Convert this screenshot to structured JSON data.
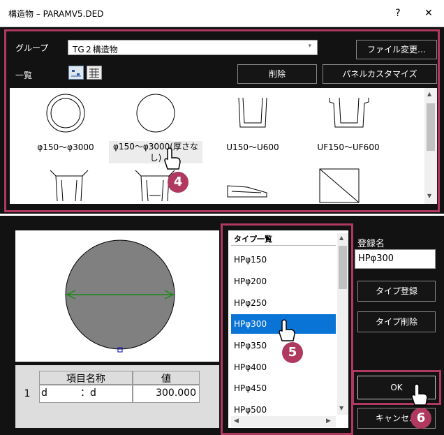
{
  "window": {
    "title": "構造物 – PARAMV5.DED",
    "help": "?",
    "close": "✕"
  },
  "top": {
    "group_label": "グループ",
    "group_value": "TG２構造物",
    "file_change": "ファイル変更…",
    "list_label": "一覧",
    "delete": "削除",
    "panel_custom": "パネルカスタマイズ"
  },
  "shapes": [
    {
      "label": "φ150～φ3000",
      "icon": "double-circle-icon"
    },
    {
      "label": "φ150～φ3000(厚さなし)",
      "icon": "circle-icon"
    },
    {
      "label": "U150～U600",
      "icon": "u-channel-icon"
    },
    {
      "label": "UF150～UF600",
      "icon": "uf-channel-icon"
    }
  ],
  "type_list": {
    "header": "タイプ一覧",
    "items": [
      "HPφ150",
      "HPφ200",
      "HPφ250",
      "HPφ300",
      "HPφ350",
      "HPφ400",
      "HPφ450",
      "HPφ500"
    ],
    "selected": "HPφ300"
  },
  "registration": {
    "label": "登録名",
    "value": "HPφ300",
    "type_register": "タイプ登録",
    "type_delete": "タイプ削除"
  },
  "table": {
    "headers": [
      "項目名称",
      "値"
    ],
    "rows": [
      {
        "num": "1",
        "name": "d",
        "colon": "：d",
        "value": "300.000"
      }
    ]
  },
  "buttons": {
    "ok": "OK",
    "cancel": "キャンセル"
  },
  "callouts": [
    "4",
    "5",
    "6"
  ],
  "colors": {
    "accent": "#b0395f",
    "selection": "#0a74d6"
  }
}
